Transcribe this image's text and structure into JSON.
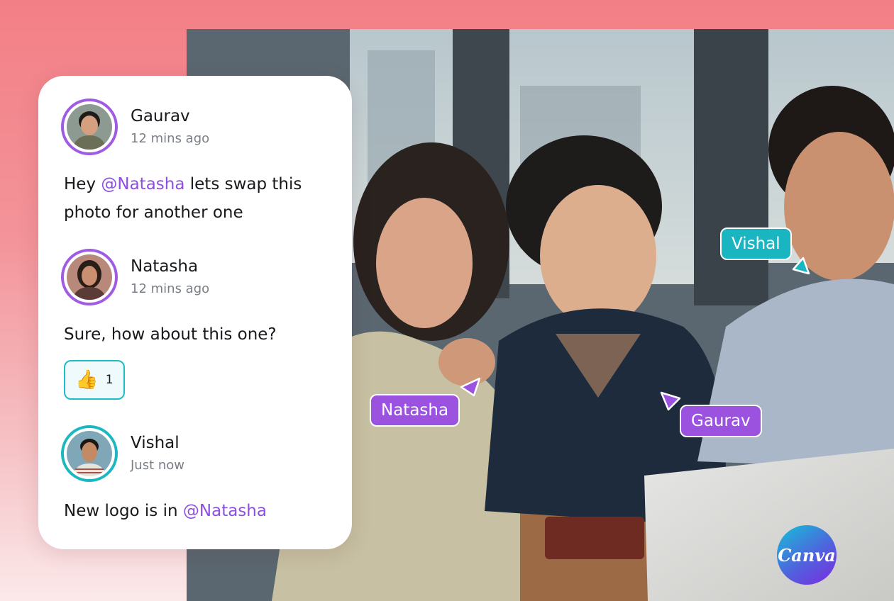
{
  "comments": [
    {
      "author": "Gaurav",
      "time": "12 mins ago",
      "text_prefix": "Hey ",
      "mention": "@Natasha",
      "text_suffix": " lets swap this photo for another one"
    },
    {
      "author": "Natasha",
      "time": "12 mins ago",
      "text": "Sure, how about this one?",
      "reaction": {
        "emoji": "👍",
        "count": "1"
      }
    },
    {
      "author": "Vishal",
      "time": "Just now",
      "text_prefix": "New logo is in ",
      "mention": "@Natasha"
    }
  ],
  "cursors": [
    {
      "label": "Vishal",
      "color": "#19b6c1"
    },
    {
      "label": "Natasha",
      "color": "#9b52de"
    },
    {
      "label": "Gaurav",
      "color": "#9b52de"
    }
  ],
  "brand": {
    "name": "Canva"
  },
  "colors": {
    "accent_purple": "#9b52de",
    "accent_teal": "#19b6c1",
    "mention": "#8e4fe0",
    "background_top": "#f37f86"
  }
}
